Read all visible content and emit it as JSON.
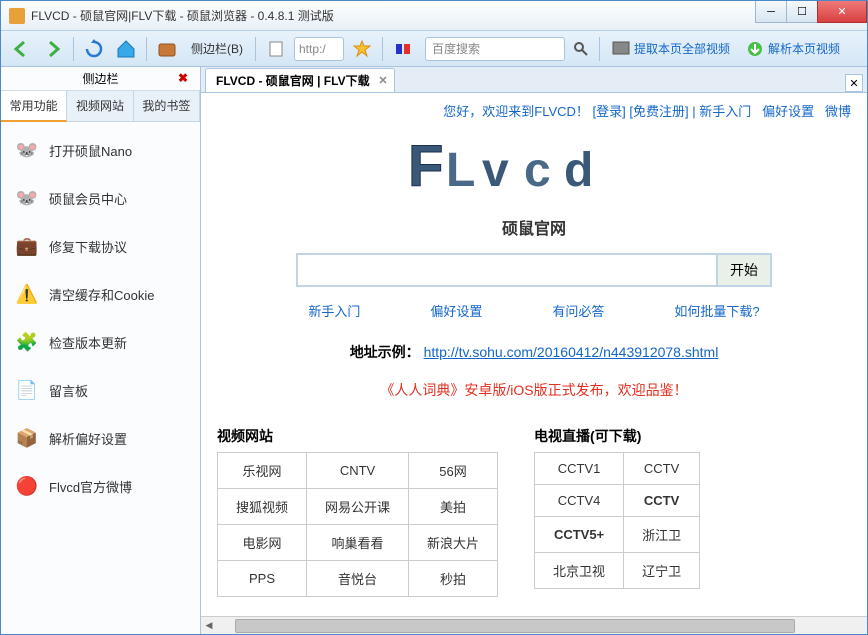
{
  "window": {
    "title": "FLVCD - 硕鼠官网|FLV下载 - 硕鼠浏览器 - 0.4.8.1 测试版"
  },
  "toolbar": {
    "sidebar_label": "侧边栏(B)",
    "url_prefix": "http:/",
    "search_placeholder": "百度搜索",
    "extract_label": "提取本页全部视频",
    "parse_label": "解析本页视频"
  },
  "sidebar": {
    "title": "侧边栏",
    "tabs": [
      {
        "label": "常用功能",
        "active": true
      },
      {
        "label": "视频网站",
        "active": false
      },
      {
        "label": "我的书签",
        "active": false
      }
    ],
    "items": [
      {
        "label": "打开硕鼠Nano",
        "icon": "🐭"
      },
      {
        "label": "硕鼠会员中心",
        "icon": "🐭"
      },
      {
        "label": "修复下载协议",
        "icon": "💼"
      },
      {
        "label": "清空缓存和Cookie",
        "icon": "⚠️"
      },
      {
        "label": "检查版本更新",
        "icon": "🧩"
      },
      {
        "label": "留言板",
        "icon": "📄"
      },
      {
        "label": "解析偏好设置",
        "icon": "📦"
      },
      {
        "label": "Flvcd官方微博",
        "icon": "🔴"
      }
    ]
  },
  "tab": {
    "label": "FLVCD - 硕鼠官网 | FLV下载"
  },
  "page": {
    "topnav": {
      "welcome": "您好，欢迎来到FLVCD！",
      "login": "[登录]",
      "register": "[免费注册]",
      "sep": " | ",
      "newbie": "新手入门",
      "prefs": "偏好设置",
      "weibo": "微博"
    },
    "logo_sub": "硕鼠官网",
    "search_button": "开始",
    "quicklinks": [
      "新手入门",
      "偏好设置",
      "有问必答",
      "如何批量下载?"
    ],
    "example_label": "地址示例：",
    "example_url": "http://tv.sohu.com/20160412/n443912078.shtml",
    "announce": "《人人词典》安卓版/iOS版正式发布，欢迎品鉴！",
    "grid_left": {
      "title": "视频网站",
      "rows": [
        [
          "乐视网",
          "CNTV",
          "56网"
        ],
        [
          "搜狐视频",
          "网易公开课",
          "美拍"
        ],
        [
          "电影网",
          "响巢看看",
          "新浪大片"
        ],
        [
          "PPS",
          "音悦台",
          "秒拍"
        ]
      ]
    },
    "grid_right": {
      "title": "电视直播(可下载)",
      "rows": [
        [
          {
            "t": "CCTV1"
          },
          {
            "t": "CCTV"
          }
        ],
        [
          {
            "t": "CCTV4"
          },
          {
            "t": "CCTV",
            "b": true
          }
        ],
        [
          {
            "t": "CCTV5+",
            "b": true
          },
          {
            "t": "浙江卫"
          }
        ],
        [
          {
            "t": "北京卫视"
          },
          {
            "t": "辽宁卫"
          }
        ]
      ]
    }
  }
}
